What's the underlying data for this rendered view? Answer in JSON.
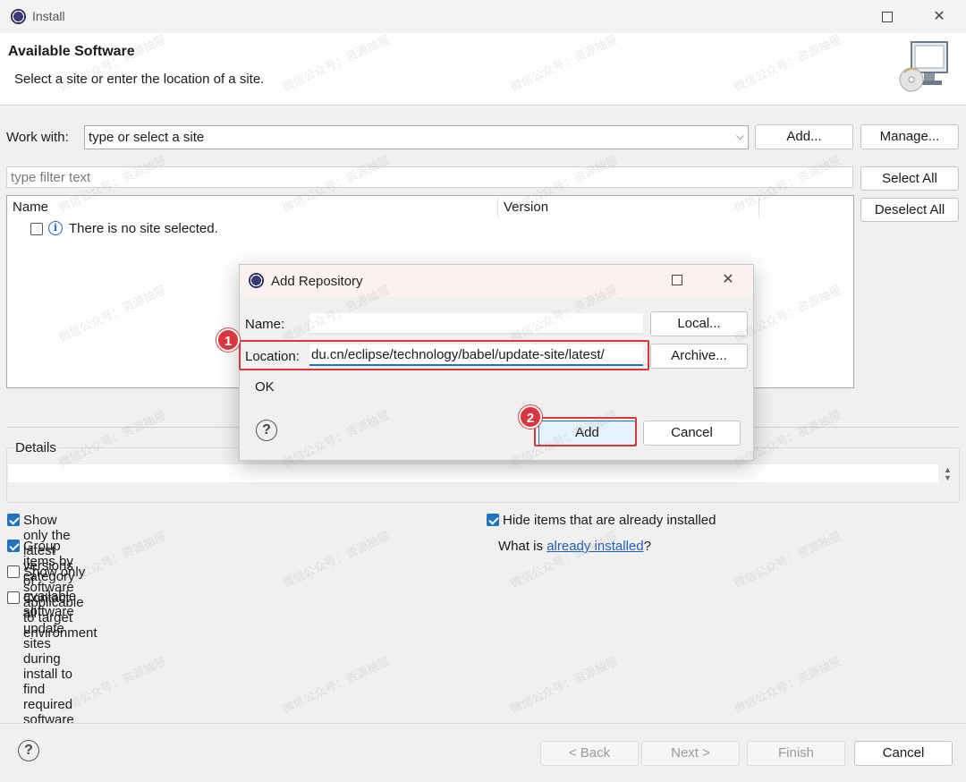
{
  "window": {
    "title": "Install"
  },
  "header": {
    "title": "Available Software",
    "description": "Select a site or enter the location of a site."
  },
  "work_with": {
    "label": "Work with:",
    "value": "type or select a site",
    "add_label": "Add...",
    "manage_label": "Manage..."
  },
  "filter": {
    "placeholder": "type filter text",
    "select_all_label": "Select All",
    "deselect_all_label": "Deselect All"
  },
  "table": {
    "columns": [
      "Name",
      "Version"
    ],
    "rows": [
      {
        "text": "There is no site selected."
      }
    ]
  },
  "details": {
    "label": "Details"
  },
  "options": {
    "show_latest": {
      "label": "Show only the latest versions of available software",
      "checked": true
    },
    "group_by_category": {
      "label": "Group items by category",
      "checked": true
    },
    "show_applicable": {
      "label": "Show only software applicable to target environment",
      "checked": false
    },
    "contact_all": {
      "label": "Contact all update sites during install to find required software",
      "checked": false
    },
    "hide_installed": {
      "label": "Hide items that are already installed",
      "checked": true
    },
    "what_is_prefix": "What is ",
    "already_installed_link": "already installed",
    "what_is_suffix": "?"
  },
  "footer": {
    "back_label": "< Back",
    "next_label": "Next >",
    "finish_label": "Finish",
    "cancel_label": "Cancel"
  },
  "dialog": {
    "title": "Add Repository",
    "name_label": "Name:",
    "name_value": "",
    "location_label": "Location:",
    "location_value": "du.cn/eclipse/technology/babel/update-site/latest/",
    "local_label": "Local...",
    "archive_label": "Archive...",
    "status": "OK",
    "add_label": "Add",
    "cancel_label": "Cancel"
  },
  "annotations": {
    "badge1": "1",
    "badge2": "2"
  },
  "watermark": "微信公众号：资源抽屉",
  "colors": {
    "accent": "#1f72c4",
    "annotation": "#d9363e",
    "link": "#1f5fbf"
  }
}
